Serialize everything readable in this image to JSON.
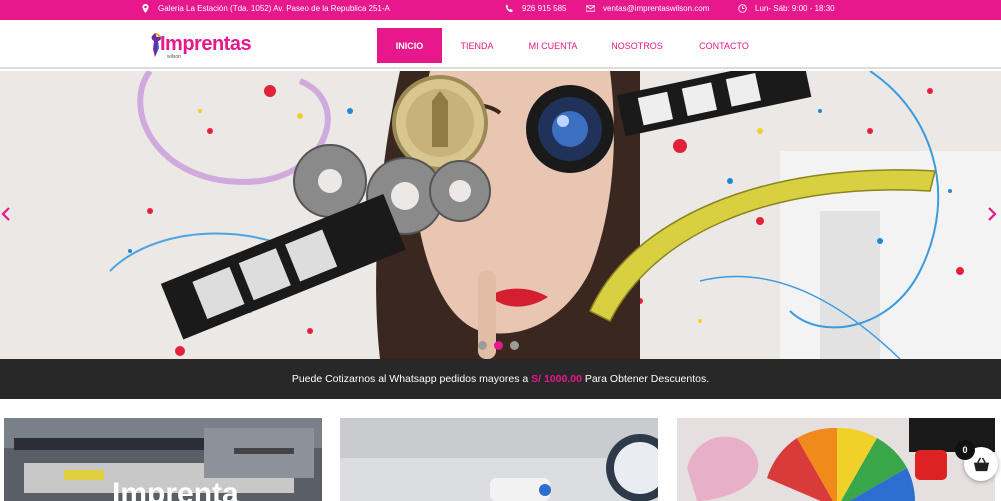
{
  "topbar": {
    "address": "Galeria La Estación (Tda. 1052) Av. Paseo de la Republica 251-A",
    "phone": "926 915 585",
    "email": "ventas@imprentaswilson.com",
    "hours": "Lun- Sáb: 9:00 - 18:30"
  },
  "logo": {
    "text": "Imprentas",
    "sub": "wilson"
  },
  "nav": {
    "items": [
      {
        "label": "INICIO",
        "active": true
      },
      {
        "label": "TIENDA"
      },
      {
        "label": "MI CUENTA"
      },
      {
        "label": "NOSOTROS"
      },
      {
        "label": "CONTACTO"
      }
    ]
  },
  "slider": {
    "prev_icon": "chevron-left-icon",
    "next_icon": "chevron-right-icon",
    "dots": {
      "count": 3,
      "active_index": 1
    }
  },
  "promo": {
    "before": "Puede Cotizarnos al Whatsapp pedidos mayores a ",
    "amount": "S/ 1000.00",
    "after": " Para Obtener Descuentos."
  },
  "cards": [
    {
      "title": "Imprenta"
    },
    {
      "title": ""
    },
    {
      "title": ""
    }
  ],
  "cart": {
    "count": "0",
    "icon": "shopping-basket-icon"
  },
  "colors": {
    "accent": "#e6188c",
    "dark": "#282828"
  }
}
